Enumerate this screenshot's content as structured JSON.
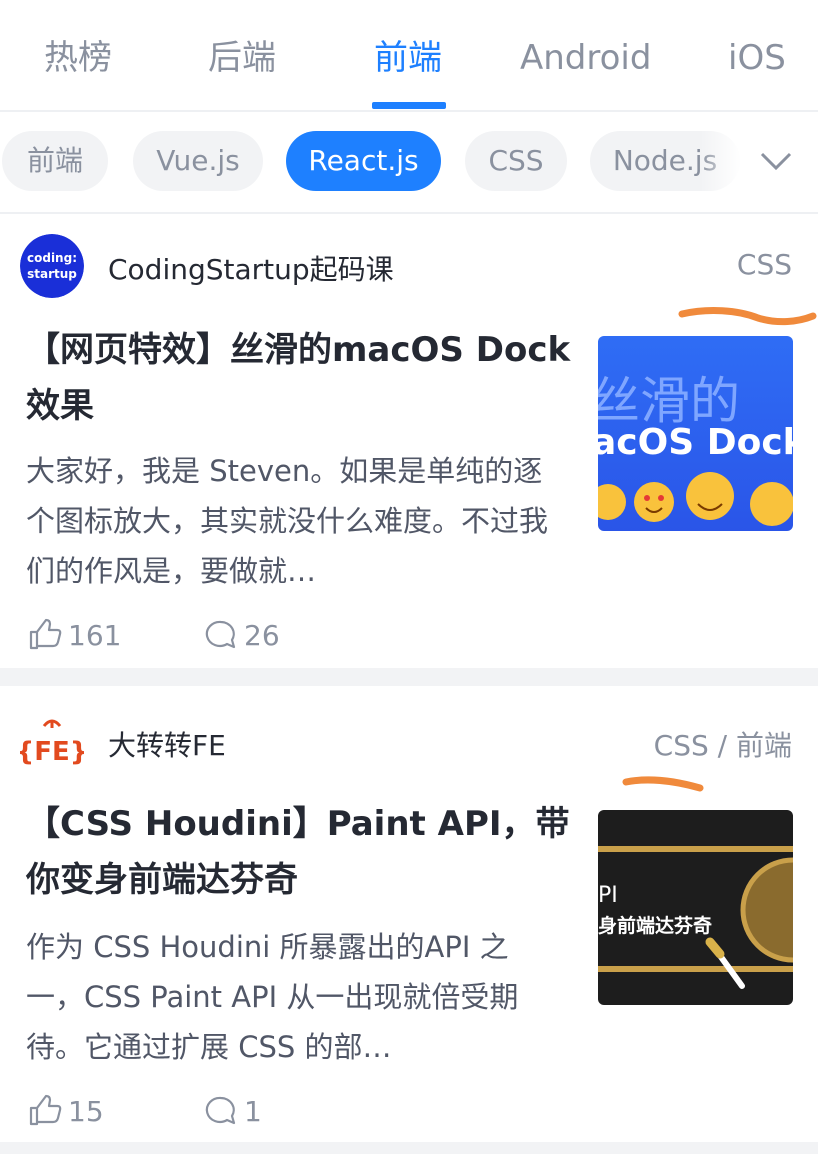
{
  "top_tabs": [
    {
      "label": "热榜"
    },
    {
      "label": "后端"
    },
    {
      "label": "前端"
    },
    {
      "label": "Android"
    },
    {
      "label": "iOS"
    }
  ],
  "active_tab_index": 2,
  "chips": [
    {
      "label": "前端"
    },
    {
      "label": "Vue.js"
    },
    {
      "label": "React.js"
    },
    {
      "label": "CSS"
    },
    {
      "label": "Node.js"
    }
  ],
  "active_chip_index": 2,
  "articles": [
    {
      "author": "CodingStartup起码课",
      "avatar_text_1": "coding:",
      "avatar_text_2": "startup",
      "tags": "CSS",
      "title": "【网页特效】丝滑的macOS Dock效果",
      "excerpt": "大家好，我是 Steven。如果是单纯的逐个图标放大，其实就没什么难度。不过我们的作风是，要做就…",
      "thumb_text_1": "丝滑的",
      "thumb_text_2": "acOS Dock",
      "likes": "161",
      "comments": "26"
    },
    {
      "author": "大转转FE",
      "avatar_text": "{FE}",
      "tags": "CSS / 前端",
      "title": "【CSS Houdini】Paint API，带你变身前端达芬奇",
      "excerpt": "作为 CSS Houdini 所暴露出的API 之一，CSS Paint API 从一出现就倍受期待。它通过扩展 CSS 的部…",
      "thumb_text_1": "PI",
      "thumb_text_2": "身前端达芬奇",
      "likes": "15",
      "comments": "1"
    }
  ],
  "colors": {
    "accent": "#1e80ff",
    "annotation": "#f08a3c",
    "muted": "#8a919f"
  }
}
